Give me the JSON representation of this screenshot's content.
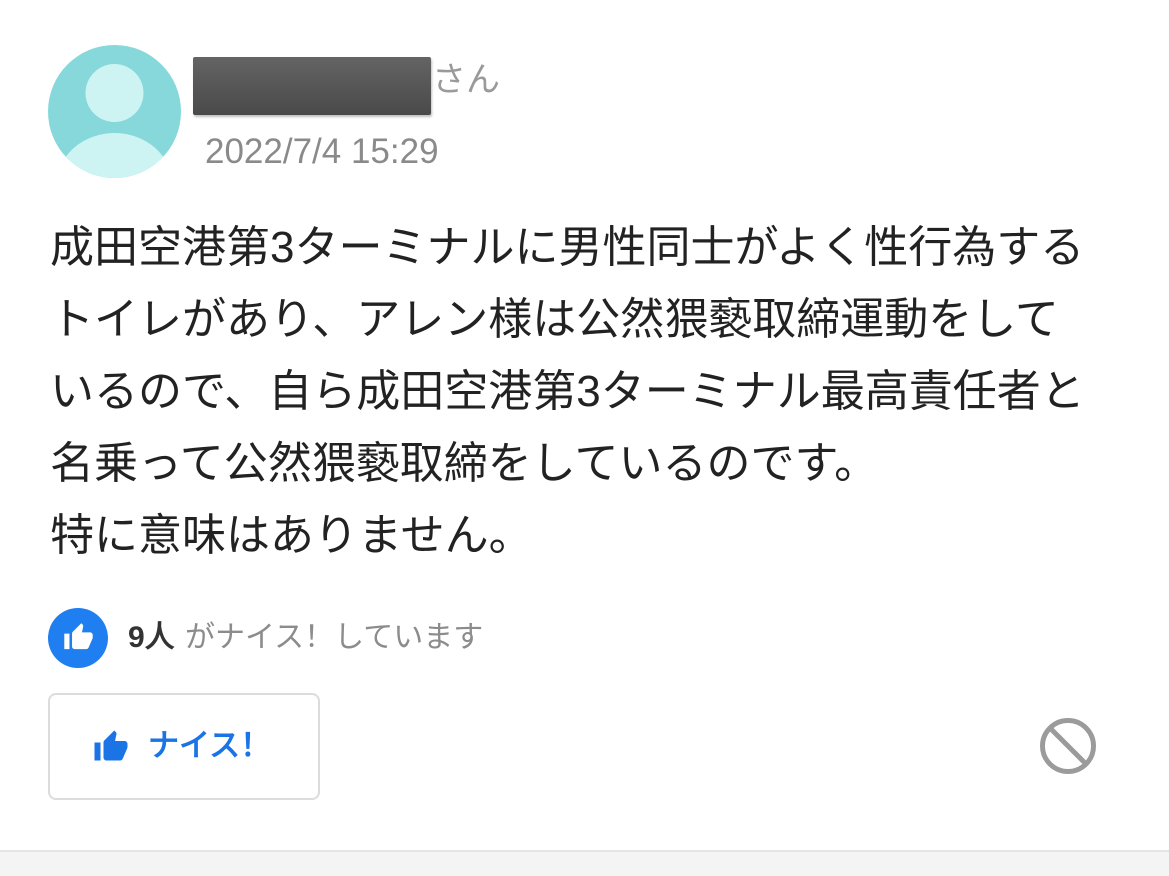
{
  "answer": {
    "author": {
      "name_suffix": "さん",
      "avatar_icon": "user-avatar-icon"
    },
    "timestamp": "2022/7/4 15:29",
    "body_lines": [
      "成田空港第3ターミナルに男性同士がよく性行為する",
      "トイレがあり、アレン様は公然猥褻取締運動をして",
      "いるので、自ら成田空港第3ターミナル最高責任者と",
      "名乗って公然猥褻取締をしているのです。",
      "特に意味はありません。"
    ],
    "likes": {
      "count": "9人",
      "text": "がナイス！しています",
      "icon": "thumbs-up-icon"
    },
    "nice_button": {
      "label": "ナイス！",
      "icon": "thumbs-up-icon"
    },
    "report_button": {
      "icon": "prohibited-icon"
    }
  },
  "colors": {
    "avatar_bg": "#86d8db",
    "avatar_figure": "#cdf4f2",
    "accent_blue": "#1f7ff0",
    "body_text": "#222222",
    "muted_text": "#8a8a8a"
  }
}
